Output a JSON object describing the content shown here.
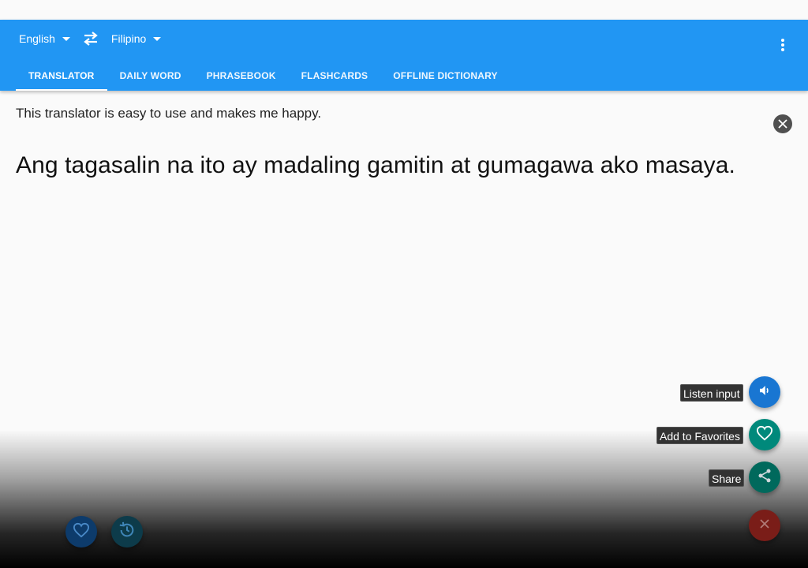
{
  "colors": {
    "appbar": "#2196f3",
    "listen_fab": "#1976d2",
    "favorites_fab": "#00897b",
    "share_fab": "#00897b",
    "close_fab": "#7a1d18"
  },
  "header": {
    "source_language": "English",
    "target_language": "Filipino",
    "swap_icon": "swap-arrows-icon",
    "menu_icon": "more-vert-icon"
  },
  "tabs": [
    {
      "label": "TRANSLATOR",
      "active": true
    },
    {
      "label": "DAILY WORD",
      "active": false
    },
    {
      "label": "PHRASEBOOK",
      "active": false
    },
    {
      "label": "FLASHCARDS",
      "active": false
    },
    {
      "label": "OFFLINE DICTIONARY",
      "active": false
    }
  ],
  "content": {
    "input_text": "This translator is easy to use and makes me happy.",
    "output_text": "Ang tagasalin na ito ay madaling gamitin at gumagawa ako masaya."
  },
  "actions": {
    "listen_label": "Listen input",
    "favorites_label": "Add to Favorites",
    "share_label": "Share"
  },
  "bottom_bar": {
    "favorites_icon": "heart-icon",
    "history_icon": "history-icon"
  }
}
